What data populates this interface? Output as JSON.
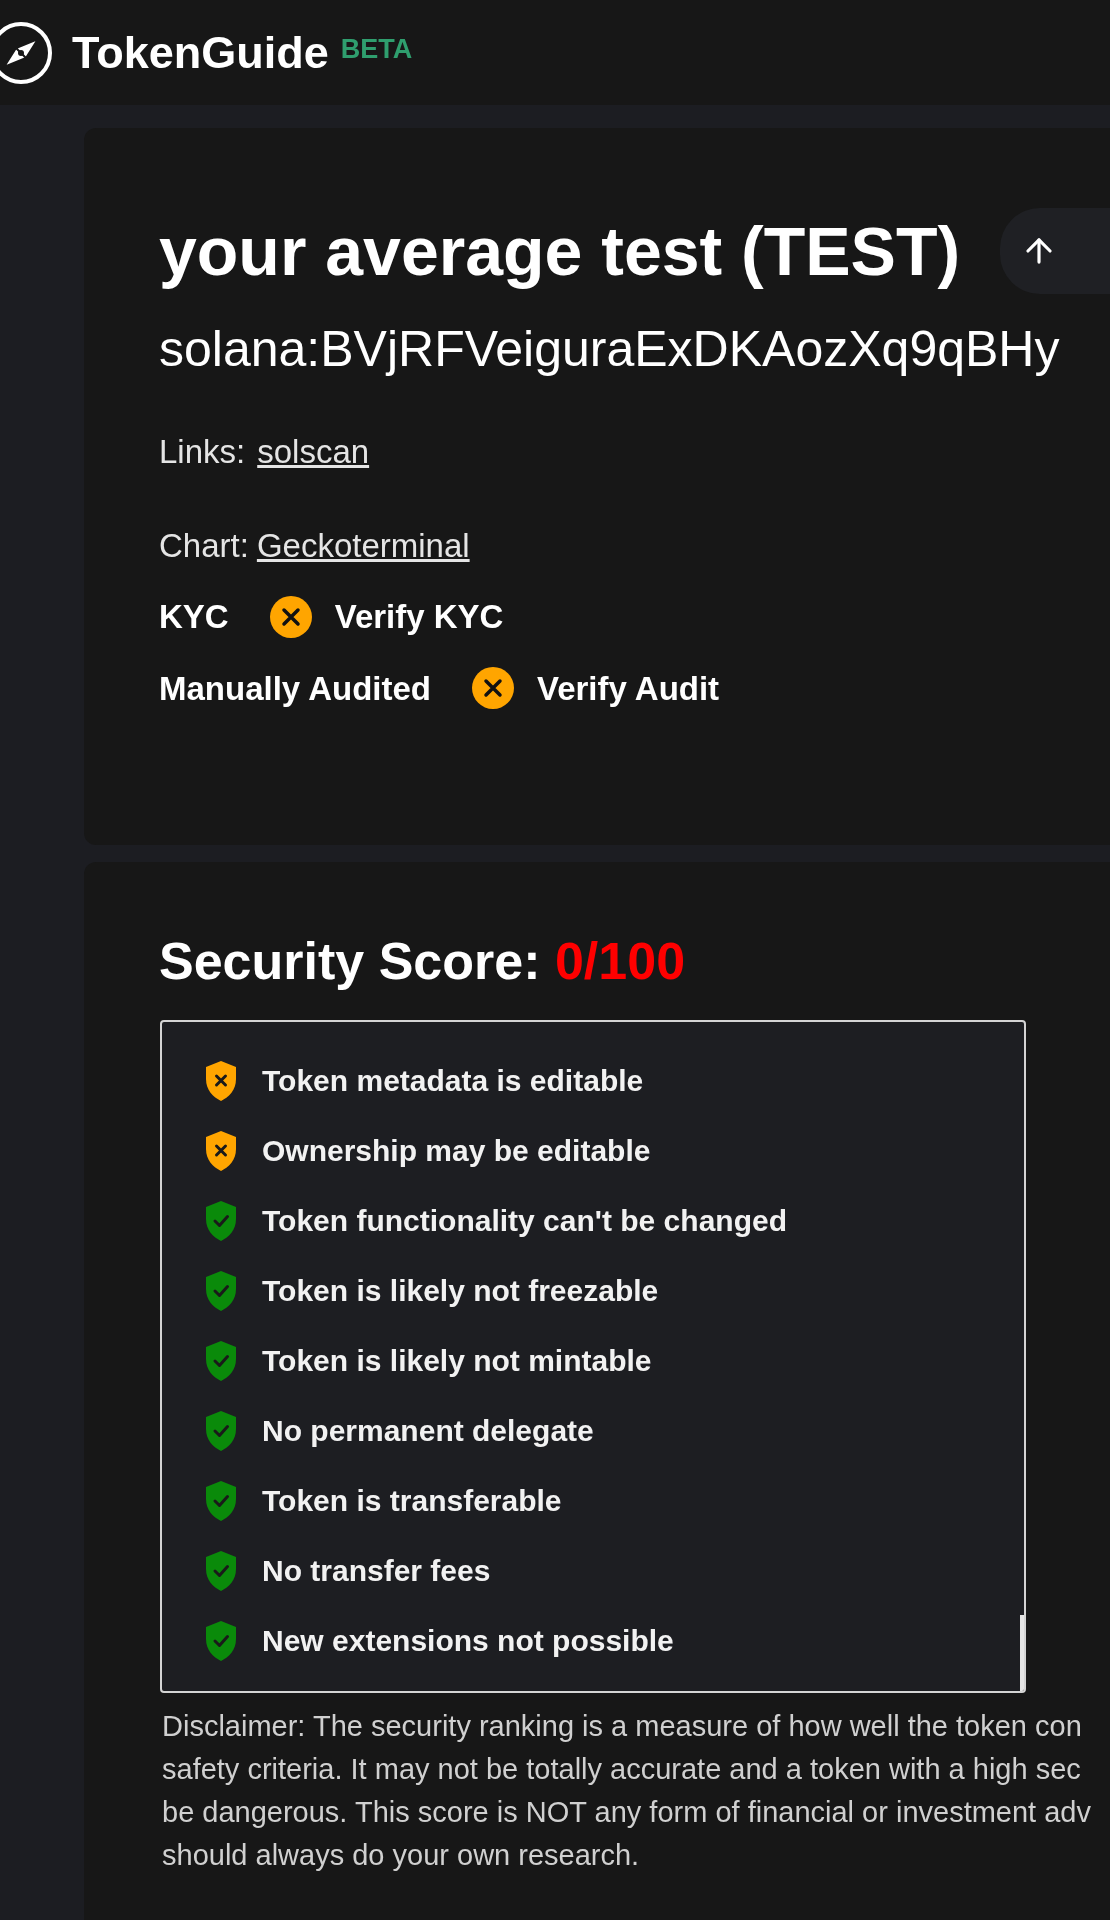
{
  "header": {
    "brand": "TokenGuide",
    "badge": "BETA"
  },
  "token": {
    "title": "your average test (TEST)",
    "address": "solana:BVjRFVeiguraExDKAozXq9qBHy",
    "links_label": "Links:",
    "links": [
      "solscan"
    ],
    "chart_label": "Chart:",
    "chart_link": "Geckoterminal",
    "verifications": [
      {
        "label": "KYC",
        "verified": false,
        "action": "Verify KYC"
      },
      {
        "label": "Manually Audited",
        "verified": false,
        "action": "Verify Audit"
      }
    ]
  },
  "security": {
    "label": "Security Score:",
    "score": "0/100",
    "checks": [
      {
        "text": "Token metadata is editable",
        "kind": "warn"
      },
      {
        "text": "Ownership may be editable",
        "kind": "warn"
      },
      {
        "text": "Token functionality can't be changed",
        "kind": "pass"
      },
      {
        "text": "Token is likely not freezable",
        "kind": "pass"
      },
      {
        "text": "Token is likely not mintable",
        "kind": "pass"
      },
      {
        "text": "No permanent delegate",
        "kind": "pass"
      },
      {
        "text": "Token is transferable",
        "kind": "pass"
      },
      {
        "text": "No transfer fees",
        "kind": "pass"
      },
      {
        "text": "New extensions not possible",
        "kind": "pass"
      }
    ],
    "disclaimer": [
      "Disclaimer: The security ranking is a measure of how well the token con",
      "safety criteria. It may not be totally accurate and a token with a high sec",
      "be dangerous. This score is NOT any form of financial or investment adv",
      "should always do your own research."
    ]
  }
}
